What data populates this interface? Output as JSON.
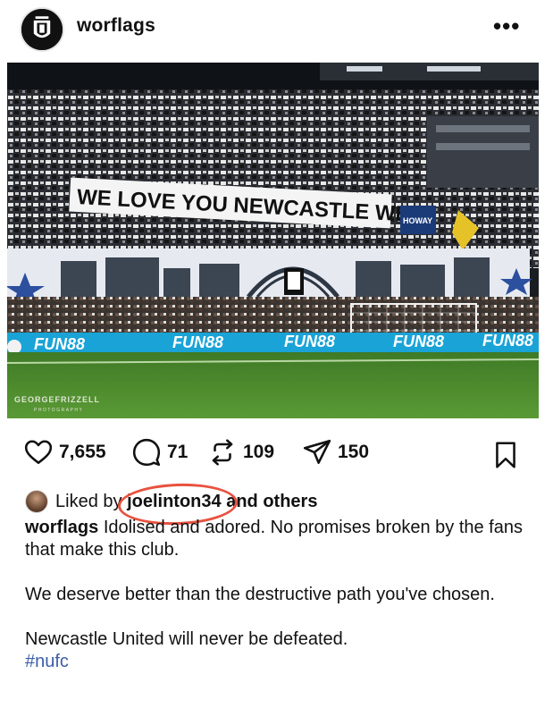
{
  "post": {
    "username": "worflags",
    "more_label": "•••",
    "avatar_alt": "worflags avatar",
    "photo": {
      "banner_text": "WE LOVE YOU NEWCASTLE WE",
      "flag_text": "HOWAY THE LADS",
      "ad_board": [
        "FUN88",
        "FUN88",
        "FUN88",
        "FUN88",
        "FUN88"
      ],
      "watermark_name": "GEORGEFRIZZELL",
      "watermark_sub": "PHOTOGRAPHY"
    },
    "actions": {
      "likes": "7,655",
      "comments": "71",
      "reposts": "109",
      "shares": "150"
    },
    "liked_by": {
      "prefix": "Liked by",
      "user": "joelinton34",
      "suffix": "and others"
    },
    "caption": {
      "user": "worflags",
      "line1": "Idolised and adored. No promises broken by the fans that make this club.",
      "paragraph2": "We deserve better than the destructive path you've chosen.",
      "paragraph3": "Newcastle United will never be defeated.",
      "hashtag": "#nufc"
    }
  },
  "colors": {
    "accent_circle": "#e8523f",
    "hashtag": "#3a5fa8",
    "pitch": "#4f8a2f",
    "ad_board": "#1aa3d6"
  }
}
